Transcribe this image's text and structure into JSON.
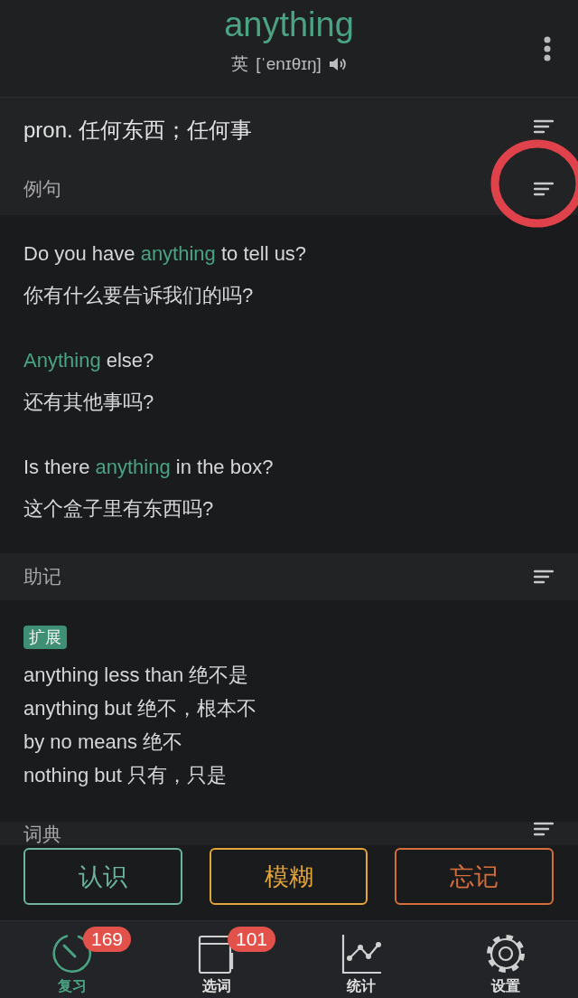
{
  "header": {
    "word": "anything",
    "accent": "英",
    "phonetic": "[ˈenɪθɪŋ]"
  },
  "meaning": "pron. 任何东西；任何事",
  "sections": [
    {
      "title": "例句",
      "kind": "examples",
      "examples": [
        {
          "en": [
            {
              "text": "Do you have "
            },
            {
              "text": "anything",
              "highlight": true
            },
            {
              "text": " to tell us?"
            }
          ],
          "zh": "你有什么要告诉我们的吗?"
        },
        {
          "en": [
            {
              "text": "Anything",
              "highlight": true
            },
            {
              "text": " else?"
            }
          ],
          "zh": "还有其他事吗?"
        },
        {
          "en": [
            {
              "text": "Is there "
            },
            {
              "text": "anything",
              "highlight": true
            },
            {
              "text": " in the box?"
            }
          ],
          "zh": "这个盒子里有东西吗?"
        }
      ]
    },
    {
      "title": "助记",
      "kind": "mnemonic",
      "tag": "扩展",
      "lines": [
        "anything less than 绝不是",
        "anything but 绝不，根本不",
        "by no means 绝不",
        "nothing but 只有，只是"
      ]
    },
    {
      "title": "词典",
      "kind": "collapsed"
    }
  ],
  "answer_buttons": [
    {
      "label": "认识",
      "color": "#6cb59c"
    },
    {
      "label": "模糊",
      "color": "#e3a53a"
    },
    {
      "label": "忘记",
      "color": "#d46f3c"
    }
  ],
  "tabs": [
    {
      "label": "复习",
      "selected": true,
      "badge": "169",
      "kind": "gauge"
    },
    {
      "label": "选词",
      "selected": false,
      "badge": "101",
      "kind": "cards"
    },
    {
      "label": "统计",
      "selected": false,
      "kind": "chart"
    },
    {
      "label": "设置",
      "selected": false,
      "kind": "gear"
    }
  ]
}
